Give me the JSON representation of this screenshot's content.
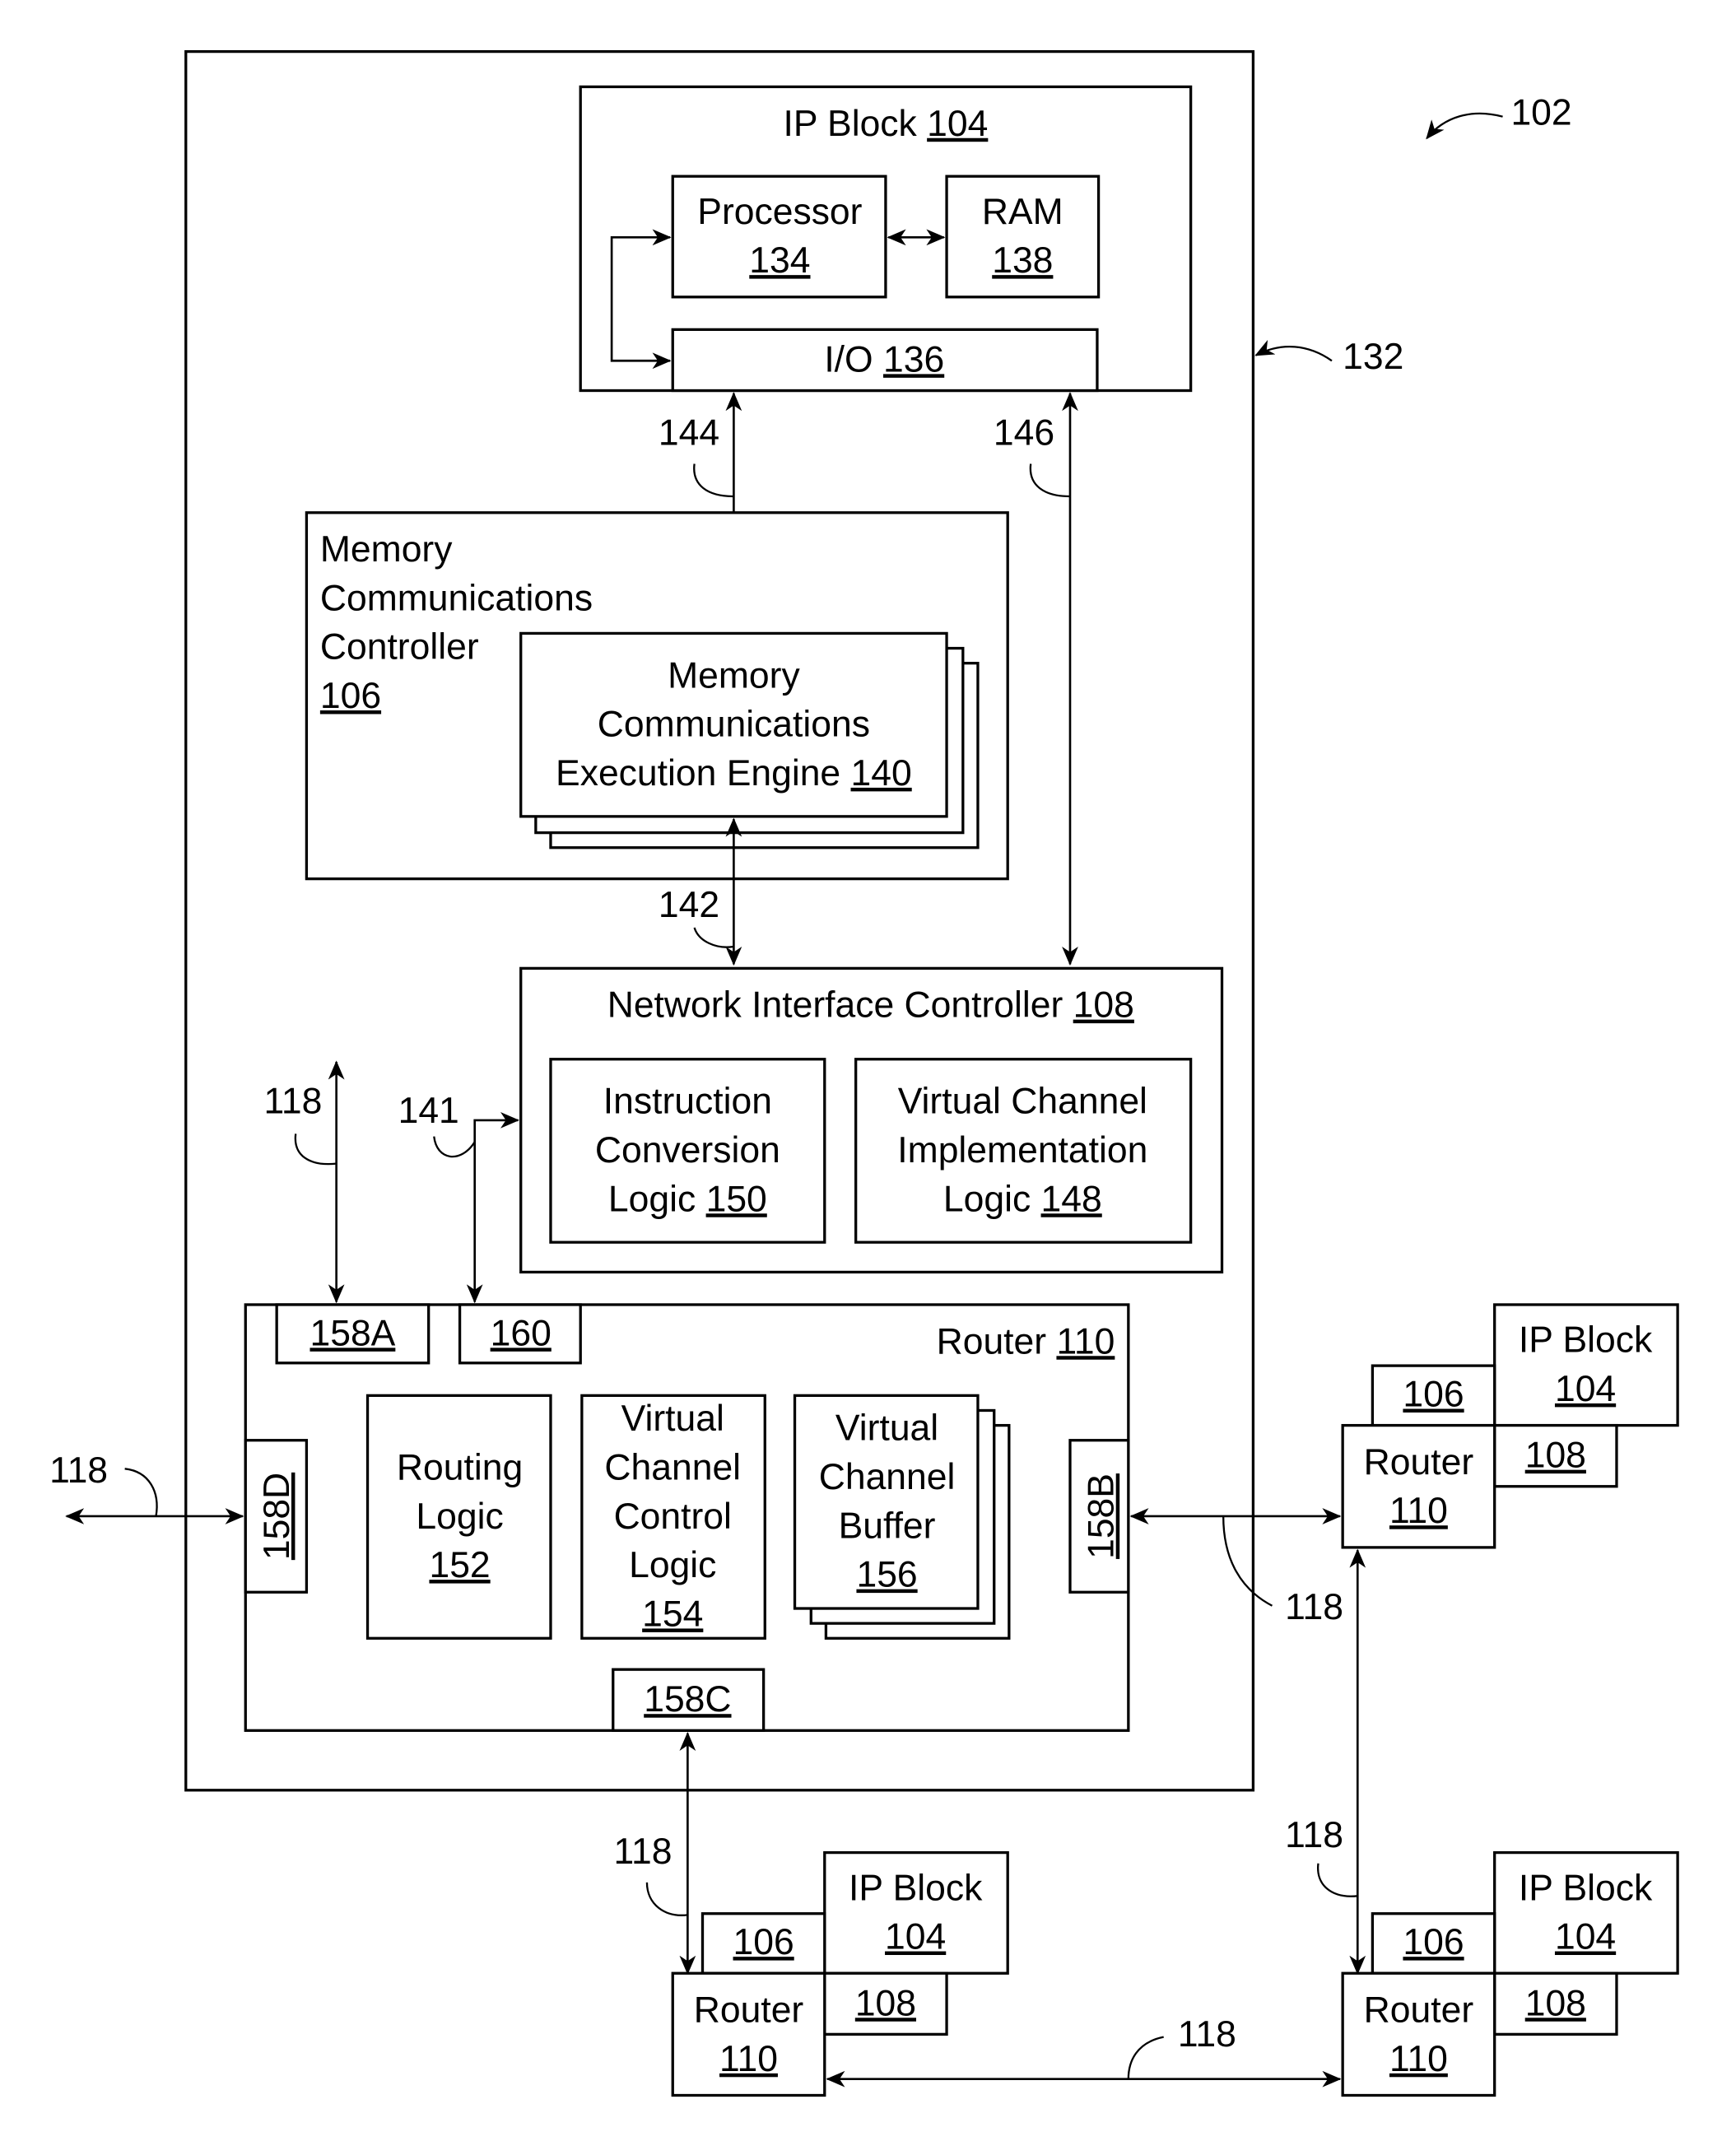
{
  "figure": {
    "figure_ref": "102",
    "chip_ref": "132",
    "ip_block": {
      "label": "IP Block",
      "ref": "104"
    },
    "processor": {
      "label": "Processor",
      "ref": "134"
    },
    "ram": {
      "label": "RAM",
      "ref": "138"
    },
    "io": {
      "label": "I/O",
      "ref": "136"
    },
    "link_144": "144",
    "link_146": "146",
    "link_142": "142",
    "link_141": "141",
    "mcc": {
      "lines": [
        "Memory",
        "Communications",
        "Controller"
      ],
      "ref": "106"
    },
    "mcee": {
      "lines": [
        "Memory",
        "Communications",
        "Execution Engine"
      ],
      "ref": "140"
    },
    "nic": {
      "label": "Network Interface Controller",
      "ref": "108"
    },
    "icl": {
      "lines": [
        "Instruction",
        "Conversion",
        "Logic"
      ],
      "ref": "150"
    },
    "vcil": {
      "lines": [
        "Virtual Channel",
        "Implementation",
        "Logic"
      ],
      "ref": "148"
    },
    "router": {
      "label": "Router",
      "ref": "110"
    },
    "ports": {
      "a": "158A",
      "b": "158B",
      "c": "158C",
      "d": "158D",
      "p160": "160"
    },
    "routing_logic": {
      "lines": [
        "Routing",
        "Logic"
      ],
      "ref": "152"
    },
    "vccl": {
      "lines": [
        "Virtual",
        "Channel",
        "Control",
        "Logic"
      ],
      "ref": "154"
    },
    "vcb": {
      "lines": [
        "Virtual",
        "Channel",
        "Buffer"
      ],
      "ref": "156"
    },
    "link_118": "118",
    "node": {
      "ip_label": "IP Block",
      "ip_ref": "104",
      "mcc_ref": "106",
      "nic_ref": "108",
      "router_label": "Router",
      "router_ref": "110"
    }
  }
}
